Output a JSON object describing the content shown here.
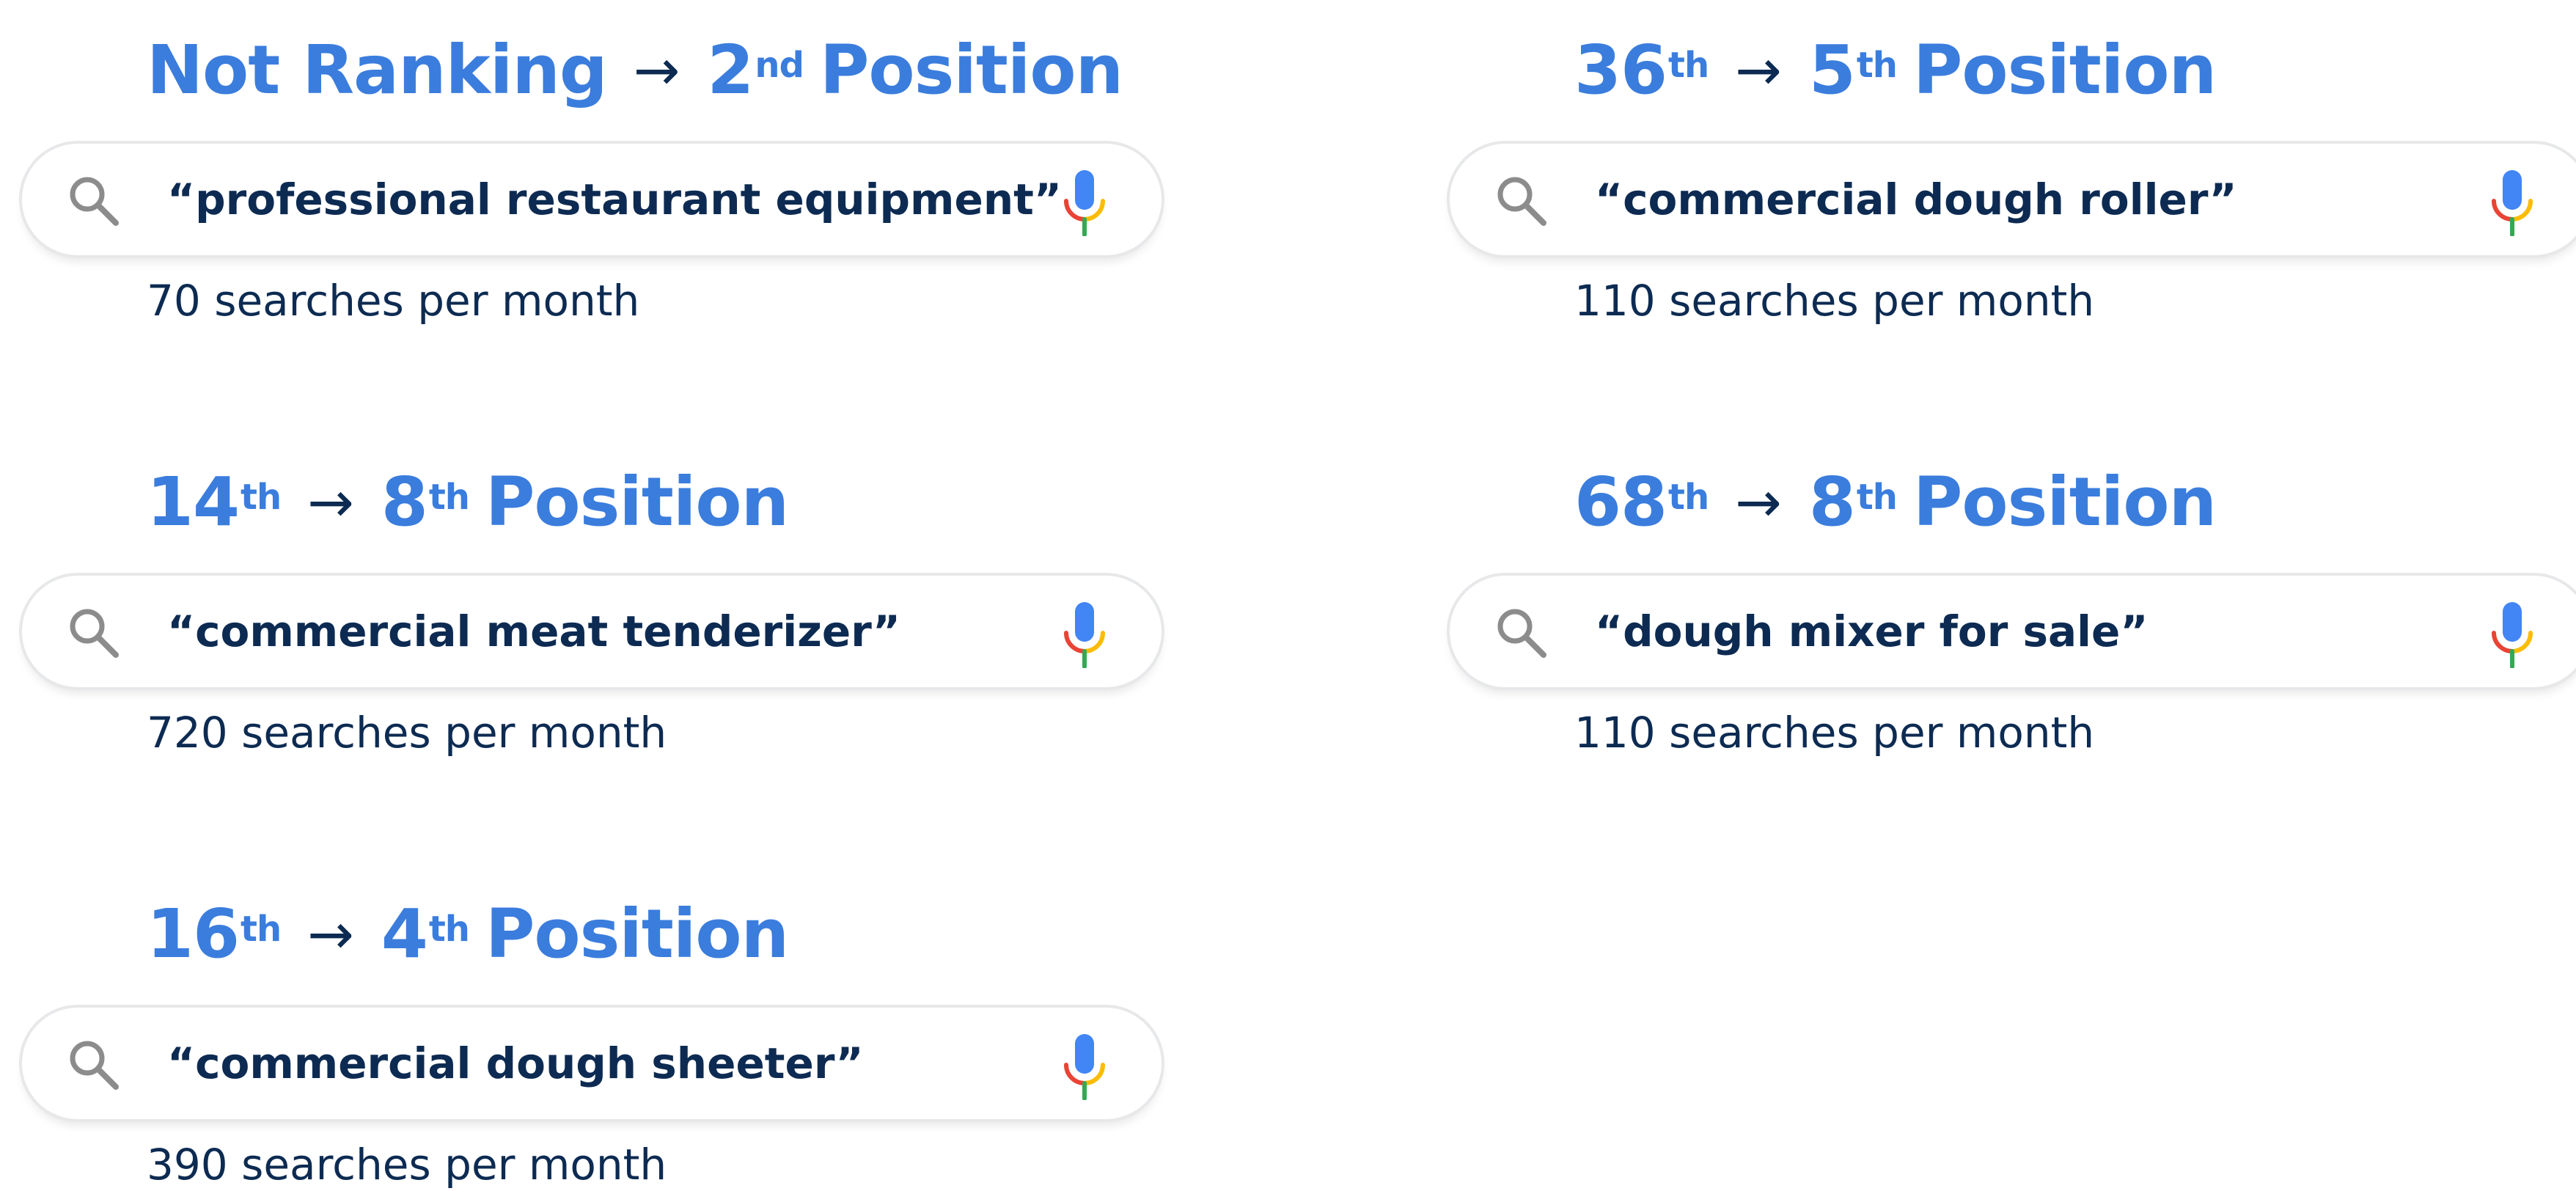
{
  "colors": {
    "heading": "#3b7ddd",
    "text": "#0d2b52",
    "search_border": "#e7e8ea",
    "search_icon": "#8c8c8c",
    "mic_blue": "#4285f4",
    "mic_red": "#ea4335",
    "mic_yellow": "#fbbc05",
    "mic_green": "#34a853"
  },
  "cards": [
    {
      "from": "Not Ranking",
      "from_suffix": "",
      "arrow": "→",
      "to": "2",
      "to_suffix": "nd",
      "position_word": "Position",
      "query": "“professional restaurant equipment”",
      "volume": "70 searches per month"
    },
    {
      "from": "36",
      "from_suffix": "th",
      "arrow": "→",
      "to": "5",
      "to_suffix": "th",
      "position_word": "Position",
      "query": "“commercial dough roller”",
      "volume": "110 searches per month"
    },
    {
      "from": "14",
      "from_suffix": "th",
      "arrow": "→",
      "to": "8",
      "to_suffix": "th",
      "position_word": "Position",
      "query": "“commercial meat tenderizer”",
      "volume": "720 searches per month"
    },
    {
      "from": "68",
      "from_suffix": "th",
      "arrow": "→",
      "to": "8",
      "to_suffix": "th",
      "position_word": "Position",
      "query": "“dough mixer for sale”",
      "volume": "110 searches per month"
    },
    {
      "from": "16",
      "from_suffix": "th",
      "arrow": "→",
      "to": "4",
      "to_suffix": "th",
      "position_word": "Position",
      "query": "“commercial dough sheeter”",
      "volume": "390 searches per month"
    }
  ]
}
